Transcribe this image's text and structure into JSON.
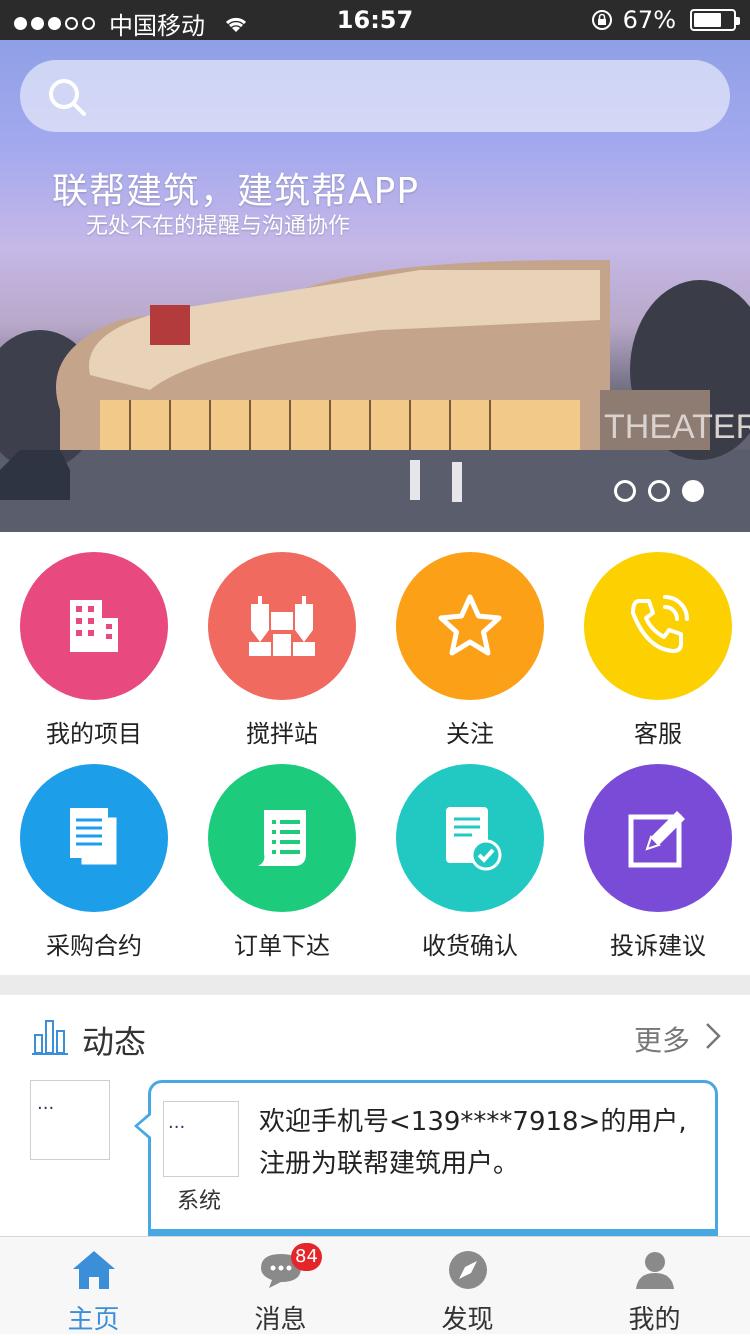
{
  "status_bar": {
    "carrier": "中国移动",
    "time": "16:57",
    "battery": "67%",
    "battery_level": 0.67,
    "signal_bars_full": 3,
    "signal_bars_total": 5
  },
  "banner": {
    "search_placeholder": "",
    "title": "联帮建筑，建筑帮APP",
    "subtitle": "无处不在的提醒与沟通协作",
    "building_sign": "THEATER",
    "pages_total": 3,
    "active_page": 3
  },
  "grid": {
    "items": [
      {
        "label": "我的项目",
        "color": "#e84a7f",
        "icon": "building-icon"
      },
      {
        "label": "搅拌站",
        "color": "#f06a5f",
        "icon": "mixing-plant-icon"
      },
      {
        "label": "关注",
        "color": "#fba017",
        "icon": "star-icon"
      },
      {
        "label": "客服",
        "color": "#fdd001",
        "icon": "phone-icon"
      },
      {
        "label": "采购合约",
        "color": "#1c9ee8",
        "icon": "documents-icon"
      },
      {
        "label": "订单下达",
        "color": "#1ccc7c",
        "icon": "scroll-list-icon"
      },
      {
        "label": "收货确认",
        "color": "#22c9c3",
        "icon": "receipt-check-icon"
      },
      {
        "label": "投诉建议",
        "color": "#7a4bd6",
        "icon": "edit-icon"
      }
    ]
  },
  "feed": {
    "title": "动态",
    "more": "更多",
    "avatar_text": "...",
    "item": {
      "avatar_text": "...",
      "sender": "系统",
      "message": "欢迎手机号<139****7918>的用户,注册为联帮建筑用户。"
    }
  },
  "tabbar": {
    "tabs": [
      {
        "label": "主页",
        "icon": "home-icon",
        "active": true
      },
      {
        "label": "消息",
        "icon": "chat-icon",
        "badge": "84"
      },
      {
        "label": "发现",
        "icon": "compass-icon"
      },
      {
        "label": "我的",
        "icon": "user-icon"
      }
    ]
  },
  "colors": {
    "accent": "#3b8fd8",
    "bubble_border": "#48a8e4",
    "badge": "#e4262a"
  }
}
